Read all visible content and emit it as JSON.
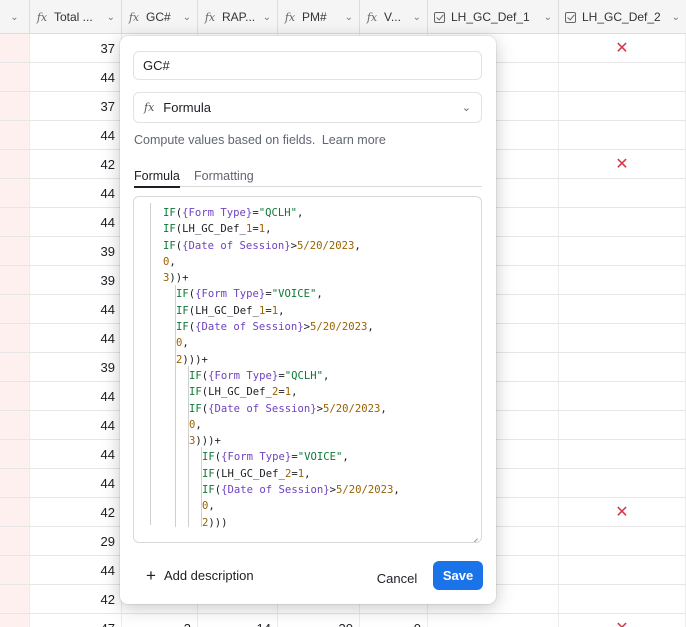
{
  "header": {
    "columns": [
      {
        "label": "Total ...",
        "icon": "formula-icon"
      },
      {
        "label": "GC#",
        "icon": "formula-icon"
      },
      {
        "label": "RAP...",
        "icon": "formula-icon"
      },
      {
        "label": "PM#",
        "icon": "formula-icon"
      },
      {
        "label": "V...",
        "icon": "formula-icon"
      },
      {
        "label": "LH_GC_Def_1",
        "icon": "checkbox-icon"
      },
      {
        "label": "LH_GC_Def_2",
        "icon": "checkbox-icon"
      }
    ]
  },
  "rows": {
    "total_values": [
      "37",
      "44",
      "37",
      "44",
      "42",
      "44",
      "44",
      "39",
      "39",
      "44",
      "44",
      "39",
      "44",
      "44",
      "44",
      "44",
      "42",
      "29",
      "44",
      "42",
      "47"
    ],
    "x_rows": [
      0,
      4,
      16,
      20
    ],
    "last_row": {
      "gc": "3",
      "rap": "14",
      "pm": "30",
      "v": "0"
    }
  },
  "popover": {
    "field_name": "GC#",
    "field_type": "Formula",
    "description": "Compute values based on fields.",
    "learn_more": "Learn more",
    "tabs": [
      "Formula",
      "Formatting"
    ],
    "add_description": "Add description",
    "cancel": "Cancel",
    "save": "Save"
  },
  "colors": {
    "accent": "#1a73e8",
    "x_mark": "#d6374a",
    "pink_cell": "#fdf0ee"
  },
  "formula_lines": [
    "IF({Form Type}=\"QCLH\",",
    "IF(LH_GC_Def_1=1,",
    "IF({Date of Session}>5/20/2023,",
    "0,",
    "3))+",
    "IF({Form Type}=\"VOICE\",",
    "IF(LH_GC_Def_1=1,",
    "IF({Date of Session}>5/20/2023,",
    "0,",
    "2)))+",
    "IF({Form Type}=\"QCLH\",",
    "IF(LH_GC_Def_2=1,",
    "IF({Date of Session}>5/20/2023,",
    "0,",
    "3)))+",
    "IF({Form Type}=\"VOICE\",",
    "IF(LH_GC_Def_2=1,",
    "IF({Date of Session}>5/20/2023,",
    "0,",
    "2)))"
  ]
}
